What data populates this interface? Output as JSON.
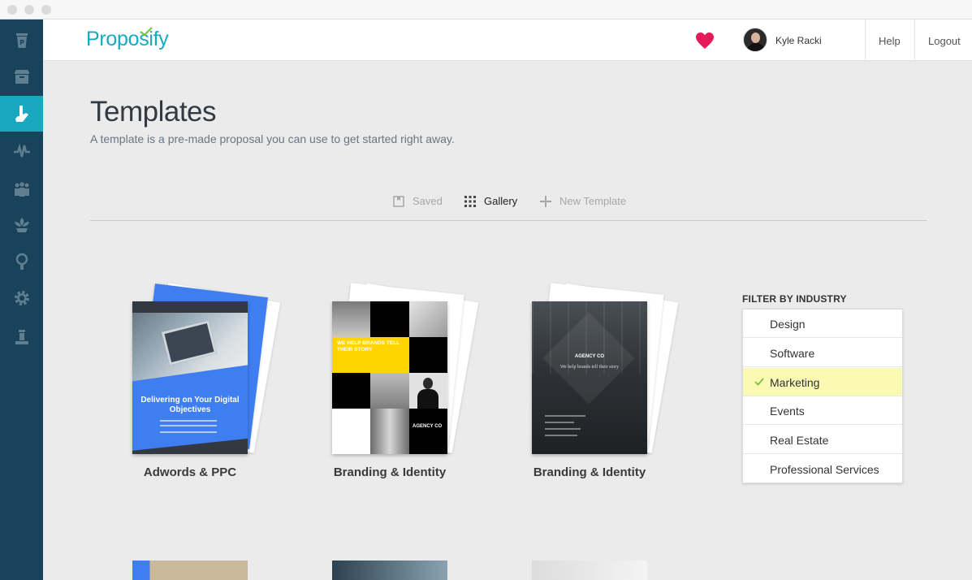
{
  "app": {
    "logo_text": "Proposify"
  },
  "colors": {
    "accent": "#1aa7c0",
    "sidebar": "#18435a",
    "heart": "#e6195b",
    "filter_selected": "#fafab4"
  },
  "sidebar": {
    "items": [
      {
        "icon": "proposify-cup-icon"
      },
      {
        "icon": "archive-box-icon"
      },
      {
        "icon": "templates-hand-icon",
        "active": true
      },
      {
        "icon": "activity-pulse-icon"
      },
      {
        "icon": "team-users-icon"
      },
      {
        "icon": "clients-lotus-icon"
      },
      {
        "icon": "lightbulb-icon"
      },
      {
        "icon": "settings-gear-icon"
      },
      {
        "icon": "library-stand-icon"
      }
    ]
  },
  "header": {
    "user_name": "Kyle Racki",
    "help_label": "Help",
    "logout_label": "Logout"
  },
  "page": {
    "title": "Templates",
    "subtitle": "A template is a pre-made proposal you can use to get started right away."
  },
  "tabs": [
    {
      "label": "Saved",
      "icon": "saved-icon",
      "state": "inactive"
    },
    {
      "label": "Gallery",
      "icon": "grid-icon",
      "state": "active"
    },
    {
      "label": "New Template",
      "icon": "plus-icon",
      "state": "inactive"
    }
  ],
  "templates": [
    {
      "label": "Adwords & PPC",
      "cover_heading": "Delivering on Your Digital Objectives",
      "style": "blue"
    },
    {
      "label": "Branding & Identity",
      "cover_heading": "WE HELP BRANDS TELL THEIR STORY",
      "cover_brand": "AGENCY CO",
      "style": "yellow-black"
    },
    {
      "label": "Branding & Identity",
      "cover_heading": "We help brands tell their story",
      "cover_brand": "AGENCY CO",
      "style": "dark"
    }
  ],
  "filter": {
    "title": "FILTER BY INDUSTRY",
    "options": [
      "Design",
      "Software",
      "Marketing",
      "Events",
      "Real Estate",
      "Professional Services"
    ],
    "selected": "Marketing"
  }
}
